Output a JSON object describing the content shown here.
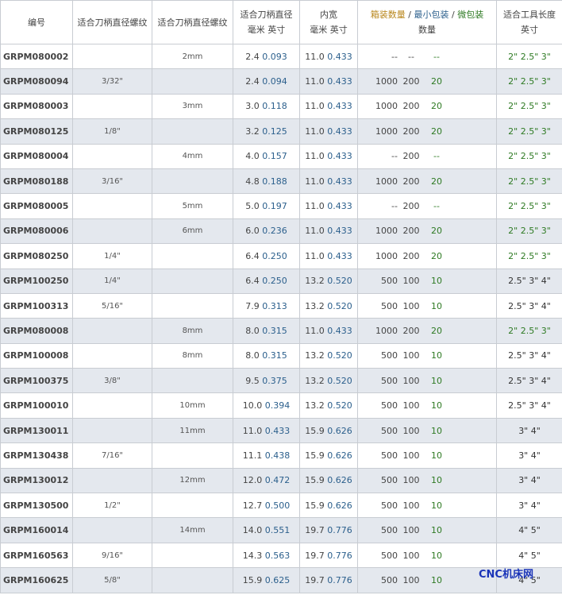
{
  "headers": {
    "code": "编号",
    "frac_thread": "适合刀柄直径螺纹",
    "mm_thread": "适合刀柄直径螺纹",
    "dia_line1": "适合刀柄直径",
    "dia_line2": "毫米 英寸",
    "bore_line1": "内宽",
    "bore_line2": "毫米 英寸",
    "pack_a": "箱装数量",
    "pack_b": "最小包装",
    "pack_c": "微包装",
    "pack_line2": "数量",
    "len_line1": "适合工具长度",
    "len_line2": "英寸"
  },
  "rows": [
    {
      "code": "GRPM080002",
      "frac": "",
      "mm": "2mm",
      "dia_mm": "2.4",
      "dia_in": "0.093",
      "bore_mm": "11.0",
      "bore_in": "0.433",
      "box": "--",
      "min": "--",
      "micro": "--",
      "len": "2\" 2.5\" 3\""
    },
    {
      "code": "GRPM080094",
      "frac": "3/32\"",
      "mm": "",
      "dia_mm": "2.4",
      "dia_in": "0.094",
      "bore_mm": "11.0",
      "bore_in": "0.433",
      "box": "1000",
      "min": "200",
      "micro": "20",
      "len": "2\" 2.5\" 3\""
    },
    {
      "code": "GRPM080003",
      "frac": "",
      "mm": "3mm",
      "dia_mm": "3.0",
      "dia_in": "0.118",
      "bore_mm": "11.0",
      "bore_in": "0.433",
      "box": "1000",
      "min": "200",
      "micro": "20",
      "len": "2\" 2.5\" 3\""
    },
    {
      "code": "GRPM080125",
      "frac": "1/8\"",
      "mm": "",
      "dia_mm": "3.2",
      "dia_in": "0.125",
      "bore_mm": "11.0",
      "bore_in": "0.433",
      "box": "1000",
      "min": "200",
      "micro": "20",
      "len": "2\" 2.5\" 3\""
    },
    {
      "code": "GRPM080004",
      "frac": "",
      "mm": "4mm",
      "dia_mm": "4.0",
      "dia_in": "0.157",
      "bore_mm": "11.0",
      "bore_in": "0.433",
      "box": "--",
      "min": "200",
      "micro": "--",
      "len": "2\" 2.5\" 3\""
    },
    {
      "code": "GRPM080188",
      "frac": "3/16\"",
      "mm": "",
      "dia_mm": "4.8",
      "dia_in": "0.188",
      "bore_mm": "11.0",
      "bore_in": "0.433",
      "box": "1000",
      "min": "200",
      "micro": "20",
      "len": "2\" 2.5\" 3\""
    },
    {
      "code": "GRPM080005",
      "frac": "",
      "mm": "5mm",
      "dia_mm": "5.0",
      "dia_in": "0.197",
      "bore_mm": "11.0",
      "bore_in": "0.433",
      "box": "--",
      "min": "200",
      "micro": "--",
      "len": "2\" 2.5\" 3\""
    },
    {
      "code": "GRPM080006",
      "frac": "",
      "mm": "6mm",
      "dia_mm": "6.0",
      "dia_in": "0.236",
      "bore_mm": "11.0",
      "bore_in": "0.433",
      "box": "1000",
      "min": "200",
      "micro": "20",
      "len": "2\" 2.5\" 3\""
    },
    {
      "code": "GRPM080250",
      "frac": "1/4\"",
      "mm": "",
      "dia_mm": "6.4",
      "dia_in": "0.250",
      "bore_mm": "11.0",
      "bore_in": "0.433",
      "box": "1000",
      "min": "200",
      "micro": "20",
      "len": "2\" 2.5\" 3\""
    },
    {
      "code": "GRPM100250",
      "frac": "1/4\"",
      "mm": "",
      "dia_mm": "6.4",
      "dia_in": "0.250",
      "bore_mm": "13.2",
      "bore_in": "0.520",
      "box": "500",
      "min": "100",
      "micro": "10",
      "len": "2.5\" 3\" 4\""
    },
    {
      "code": "GRPM100313",
      "frac": "5/16\"",
      "mm": "",
      "dia_mm": "7.9",
      "dia_in": "0.313",
      "bore_mm": "13.2",
      "bore_in": "0.520",
      "box": "500",
      "min": "100",
      "micro": "10",
      "len": "2.5\" 3\" 4\""
    },
    {
      "code": "GRPM080008",
      "frac": "",
      "mm": "8mm",
      "dia_mm": "8.0",
      "dia_in": "0.315",
      "bore_mm": "11.0",
      "bore_in": "0.433",
      "box": "1000",
      "min": "200",
      "micro": "20",
      "len": "2\" 2.5\" 3\""
    },
    {
      "code": "GRPM100008",
      "frac": "",
      "mm": "8mm",
      "dia_mm": "8.0",
      "dia_in": "0.315",
      "bore_mm": "13.2",
      "bore_in": "0.520",
      "box": "500",
      "min": "100",
      "micro": "10",
      "len": "2.5\" 3\" 4\""
    },
    {
      "code": "GRPM100375",
      "frac": "3/8\"",
      "mm": "",
      "dia_mm": "9.5",
      "dia_in": "0.375",
      "bore_mm": "13.2",
      "bore_in": "0.520",
      "box": "500",
      "min": "100",
      "micro": "10",
      "len": "2.5\" 3\" 4\""
    },
    {
      "code": "GRPM100010",
      "frac": "",
      "mm": "10mm",
      "dia_mm": "10.0",
      "dia_in": "0.394",
      "bore_mm": "13.2",
      "bore_in": "0.520",
      "box": "500",
      "min": "100",
      "micro": "10",
      "len": "2.5\" 3\" 4\""
    },
    {
      "code": "GRPM130011",
      "frac": "",
      "mm": "11mm",
      "dia_mm": "11.0",
      "dia_in": "0.433",
      "bore_mm": "15.9",
      "bore_in": "0.626",
      "box": "500",
      "min": "100",
      "micro": "10",
      "len": "3\" 4\""
    },
    {
      "code": "GRPM130438",
      "frac": "7/16\"",
      "mm": "",
      "dia_mm": "11.1",
      "dia_in": "0.438",
      "bore_mm": "15.9",
      "bore_in": "0.626",
      "box": "500",
      "min": "100",
      "micro": "10",
      "len": "3\" 4\""
    },
    {
      "code": "GRPM130012",
      "frac": "",
      "mm": "12mm",
      "dia_mm": "12.0",
      "dia_in": "0.472",
      "bore_mm": "15.9",
      "bore_in": "0.626",
      "box": "500",
      "min": "100",
      "micro": "10",
      "len": "3\" 4\""
    },
    {
      "code": "GRPM130500",
      "frac": "1/2\"",
      "mm": "",
      "dia_mm": "12.7",
      "dia_in": "0.500",
      "bore_mm": "15.9",
      "bore_in": "0.626",
      "box": "500",
      "min": "100",
      "micro": "10",
      "len": "3\" 4\""
    },
    {
      "code": "GRPM160014",
      "frac": "",
      "mm": "14mm",
      "dia_mm": "14.0",
      "dia_in": "0.551",
      "bore_mm": "19.7",
      "bore_in": "0.776",
      "box": "500",
      "min": "100",
      "micro": "10",
      "len": "4\" 5\""
    },
    {
      "code": "GRPM160563",
      "frac": "9/16\"",
      "mm": "",
      "dia_mm": "14.3",
      "dia_in": "0.563",
      "bore_mm": "19.7",
      "bore_in": "0.776",
      "box": "500",
      "min": "100",
      "micro": "10",
      "len": "4\" 5\""
    },
    {
      "code": "GRPM160625",
      "frac": "5/8\"",
      "mm": "",
      "dia_mm": "15.9",
      "dia_in": "0.625",
      "bore_mm": "19.7",
      "bore_in": "0.776",
      "box": "500",
      "min": "100",
      "micro": "10",
      "len": "4\" 5\""
    }
  ],
  "watermark": "CNC机床网",
  "colors": {
    "blue": "#2b5f8c",
    "green": "#2e7a23",
    "gold": "#b8861b",
    "row_alt": "#e4e8ee"
  }
}
